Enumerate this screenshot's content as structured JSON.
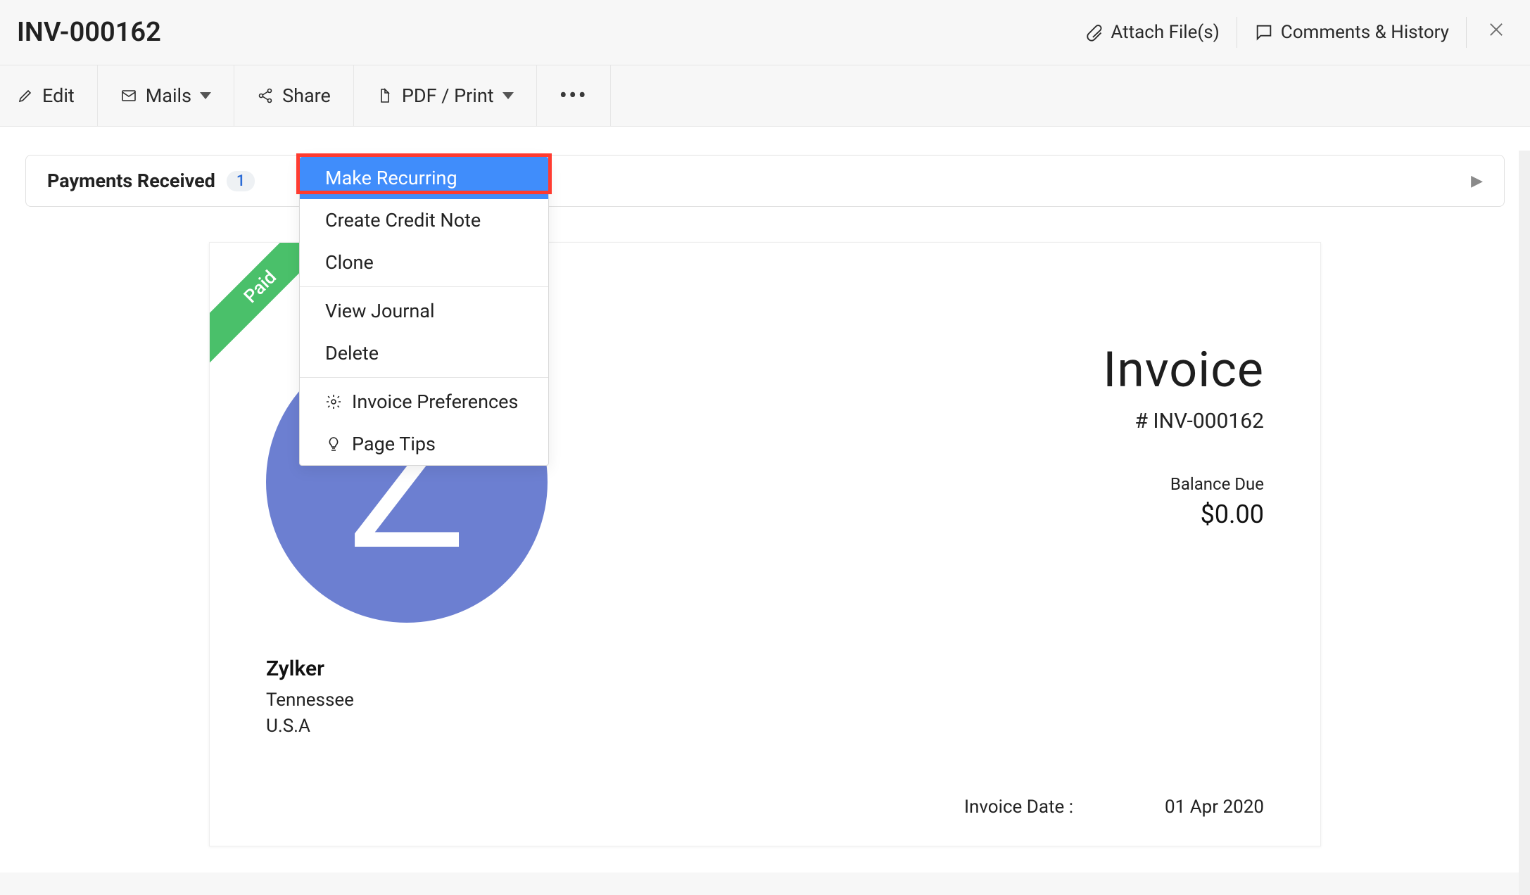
{
  "header": {
    "title": "INV-000162",
    "attach_label": "Attach File(s)",
    "comments_label": "Comments & History"
  },
  "toolbar": {
    "edit": "Edit",
    "mails": "Mails",
    "share": "Share",
    "pdf_print": "PDF / Print"
  },
  "dropdown": {
    "make_recurring": "Make Recurring",
    "create_credit_note": "Create Credit Note",
    "clone": "Clone",
    "view_journal": "View Journal",
    "delete": "Delete",
    "invoice_preferences": "Invoice Preferences",
    "page_tips": "Page Tips"
  },
  "payments": {
    "label": "Payments Received",
    "count": "1"
  },
  "invoice": {
    "ribbon": "Paid",
    "logo_letter": "Z",
    "company_name": "Zylker",
    "company_state": "Tennessee",
    "company_country": "U.S.A",
    "doc_title": "Invoice",
    "doc_number": "# INV-000162",
    "balance_label": "Balance Due",
    "balance_value": "$0.00",
    "date_label": "Invoice Date :",
    "date_value": "01 Apr 2020"
  }
}
